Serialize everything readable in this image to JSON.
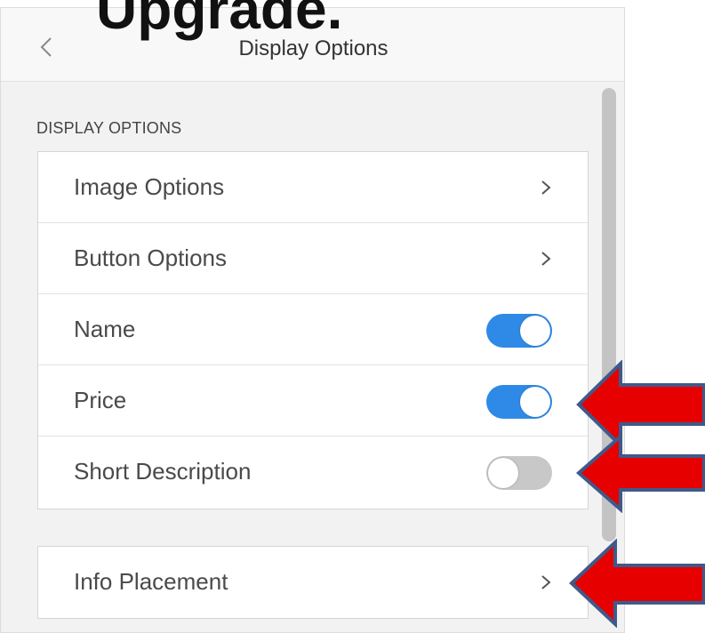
{
  "banner": {
    "text": "Upgrade."
  },
  "header": {
    "title": "Display Options",
    "back_icon": "chevron-left-icon"
  },
  "section": {
    "label": "DISPLAY OPTIONS"
  },
  "options": [
    {
      "label": "Image Options",
      "kind": "link",
      "icon": "chevron-right-icon"
    },
    {
      "label": "Button Options",
      "kind": "link",
      "icon": "chevron-right-icon"
    },
    {
      "label": "Name",
      "kind": "toggle",
      "enabled": true
    },
    {
      "label": "Price",
      "kind": "toggle",
      "enabled": true
    },
    {
      "label": "Short Description",
      "kind": "toggle",
      "enabled": false
    }
  ],
  "info": {
    "label": "Info Placement",
    "icon": "chevron-right-icon"
  },
  "colors": {
    "toggle_on": "#2e8ae6",
    "toggle_off": "#c8c8c8",
    "arrow_fill": "#e60000",
    "arrow_outline": "#3f5a8a"
  },
  "annotations": [
    {
      "icon": "red-arrow-icon",
      "points_to": "Price"
    },
    {
      "icon": "red-arrow-icon",
      "points_to": "Short Description"
    },
    {
      "icon": "red-arrow-icon",
      "points_to": "Info Placement"
    }
  ]
}
